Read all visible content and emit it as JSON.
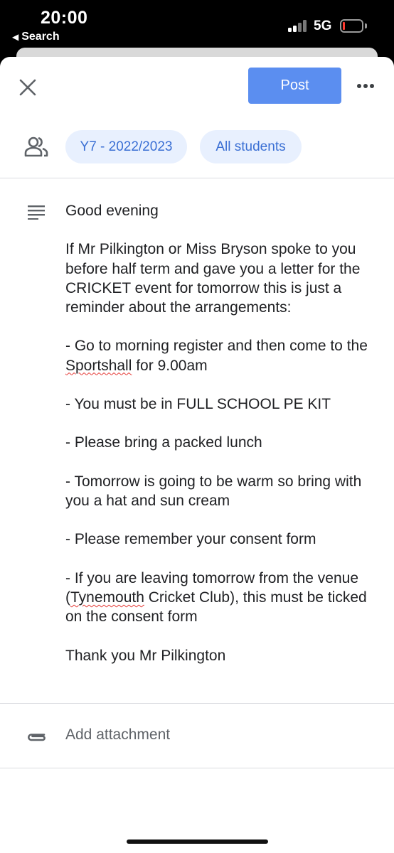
{
  "status_bar": {
    "time": "20:00",
    "back_label": "Search",
    "network": "5G",
    "battery_color": "#ff3b30"
  },
  "toolbar": {
    "close_icon": "close-icon",
    "post_label": "Post",
    "more_icon": "more-horiz-icon",
    "accent_color": "#5b8ef0"
  },
  "audience": {
    "icon": "people-icon",
    "class_chip": "Y7 - 2022/2023",
    "students_chip": "All students"
  },
  "announcement": {
    "icon": "notes-icon",
    "greeting": "Good evening",
    "intro": "If Mr Pilkington or Miss Bryson spoke to you before half term and gave you a letter for the CRICKET event for tomorrow this is just a reminder about the arrangements:",
    "item1_before": "- Go to morning register and then come to the ",
    "item1_flagged": "Sportshall",
    "item1_after": " for 9.00am",
    "item2": "- You must be in FULL SCHOOL PE KIT",
    "item3": "- Please bring a packed lunch",
    "item4": "- Tomorrow is going to be warm so bring with you a hat and sun cream",
    "item5": "- Please remember your consent form",
    "item6_before": "- If you are leaving tomorrow from the venue (",
    "item6_flagged": "Tynemouth",
    "item6_after": " Cricket Club), this must be ticked on the consent form",
    "signoff": "Thank you Mr Pilkington"
  },
  "attachment": {
    "icon": "paperclip-icon",
    "label": "Add attachment"
  }
}
